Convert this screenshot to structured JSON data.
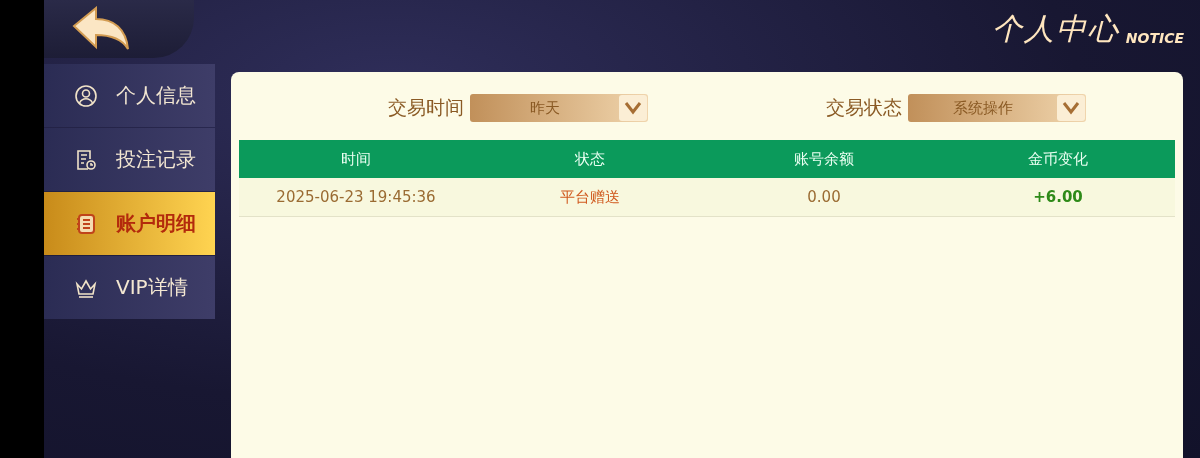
{
  "header": {
    "title": "个人中心",
    "subtitle": "NOTICE"
  },
  "sidebar": {
    "items": [
      {
        "label": "个人信息",
        "kind": "person",
        "selected": false
      },
      {
        "label": "投注记录",
        "kind": "record",
        "selected": false
      },
      {
        "label": "账户明细",
        "kind": "ledger",
        "selected": true
      },
      {
        "label": "VIP详情",
        "kind": "crown",
        "selected": false
      }
    ]
  },
  "filters": [
    {
      "label": "交易时间",
      "value": "昨天"
    },
    {
      "label": "交易状态",
      "value": "系统操作"
    }
  ],
  "table": {
    "columns": [
      "时间",
      "状态",
      "账号余额",
      "金币变化"
    ],
    "rows": [
      {
        "cells": [
          "2025-06-23 19:45:36",
          "平台赠送",
          "0.00",
          "+6.00"
        ]
      }
    ]
  }
}
